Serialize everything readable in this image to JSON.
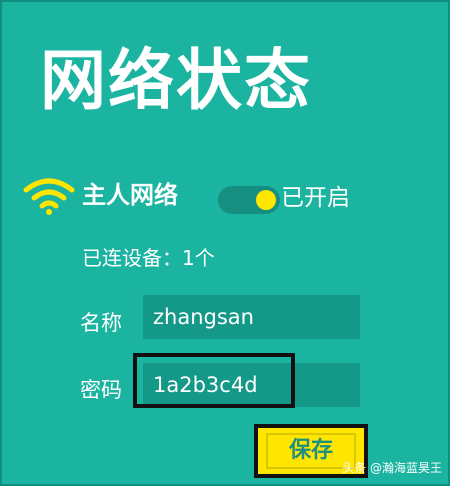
{
  "page": {
    "title": "网络状态"
  },
  "host_network": {
    "label": "主人网络",
    "toggle_status": "已开启",
    "connected_devices": "已连设备：1个"
  },
  "form": {
    "name_label": "名称",
    "name_value": "zhangsan",
    "password_label": "密码",
    "password_value": "1a2b3c4d",
    "save_label": "保存"
  },
  "watermark": {
    "text": "头条 @瀚海蓝昊王"
  },
  "colors": {
    "background": "#1ab4a0",
    "field": "#149887",
    "accent": "#ffe600",
    "highlight_border": "#111111"
  },
  "icons": {
    "wifi": "wifi-icon"
  }
}
